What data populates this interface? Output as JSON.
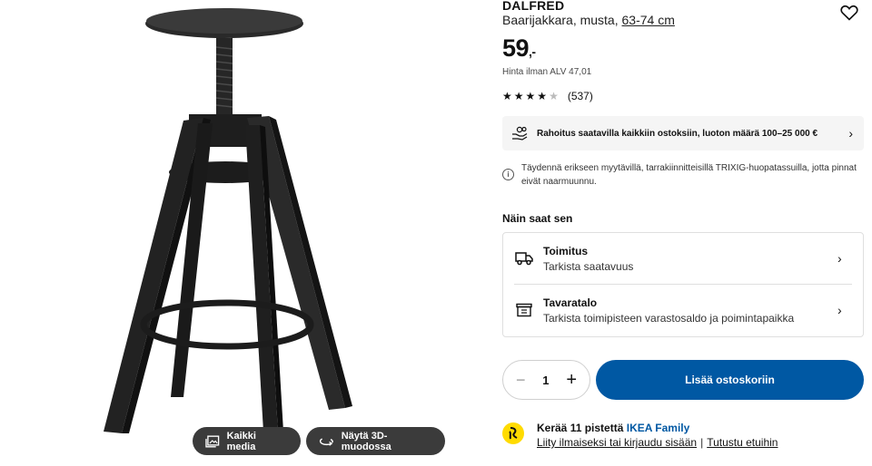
{
  "gallery": {
    "all_media_label": "Kaikki media",
    "view_3d_label": "Näytä 3D-muodossa"
  },
  "product": {
    "name": "DALFRED",
    "description": "Baarijakkara, musta,",
    "size_link": "63-74 cm",
    "price_integer": "59",
    "price_separator": ",-",
    "vat_text": "Hinta ilman ALV 47,01",
    "rating_value": 4.5,
    "rating_count": "(537)"
  },
  "financing": {
    "text": "Rahoitus saatavilla kaikkiin ostoksiin, luoton määrä 100–25 000 €"
  },
  "notice": {
    "icon": "info-icon",
    "text": "Täydennä erikseen myytävillä, tarrakiinnitteisillä TRIXIG-huopatassuilla, jotta pinnat eivät naarmuunnu."
  },
  "fulfilment": {
    "heading": "Näin saat sen",
    "options": [
      {
        "icon": "truck-icon",
        "title": "Toimitus",
        "subtitle": "Tarkista saatavuus"
      },
      {
        "icon": "store-icon",
        "title": "Tavaratalo",
        "subtitle": "Tarkista toimipisteen varastosaldo ja poimintapaikka"
      }
    ]
  },
  "purchase": {
    "quantity": "1",
    "add_to_cart_label": "Lisää ostoskoriin"
  },
  "family": {
    "points_text": "Kerää 11 pistettä",
    "brand": "IKEA Family",
    "join_link": "Liity ilmaiseksi tai kirjaudu sisään",
    "separator": "|",
    "benefits_link": "Tutustu etuihin"
  },
  "colors": {
    "accent_blue": "#0058a3",
    "family_yellow": "#ffdb00",
    "media_button": "#3b3b3b"
  }
}
